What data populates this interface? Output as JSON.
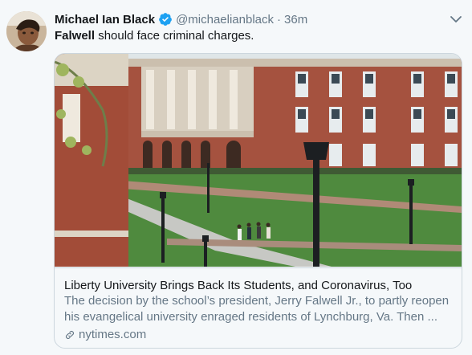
{
  "tweet": {
    "author_name": "Michael Ian Black",
    "handle": "@michaelianblack",
    "separator": "·",
    "time": "36m",
    "text_bold": "Falwell",
    "text_rest": " should face criminal charges."
  },
  "card": {
    "title": "Liberty University Brings Back Its Students, and Coronavirus, Too",
    "description_lines": [
      "The decision by the school’s president, Jerry Falwell Jr., to partly reopen",
      "his evangelical university enraged residents of Lynchburg, Va. Then ..."
    ],
    "domain": "nytimes.com"
  },
  "icons": {
    "verified": "verified-badge-icon",
    "more": "chevron-down-icon",
    "link": "link-icon"
  },
  "colors": {
    "accent": "#1da1f2",
    "secondary_text": "#657786",
    "primary_text": "#14171a",
    "border": "#ccd6dd"
  }
}
